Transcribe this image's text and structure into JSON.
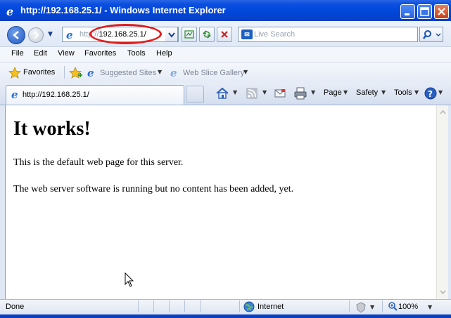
{
  "window": {
    "title": "http://192.168.25.1/ - Windows Internet Explorer"
  },
  "address_bar": {
    "prefix": "http://",
    "host": "192.168.25.1/"
  },
  "search": {
    "placeholder": "Live Search"
  },
  "menu": {
    "items": [
      "File",
      "Edit",
      "View",
      "Favorites",
      "Tools",
      "Help"
    ]
  },
  "favorites_bar": {
    "label": "Favorites",
    "links": [
      "Suggested Sites",
      "Web Slice Gallery"
    ]
  },
  "tab": {
    "label": "http://192.168.25.1/"
  },
  "command_bar": {
    "page": "Page",
    "safety": "Safety",
    "tools": "Tools"
  },
  "page": {
    "heading": "It works!",
    "paragraphs": [
      "This is the default web page for this server.",
      "The web server software is running but no content has been added, yet."
    ]
  },
  "status": {
    "text": "Done",
    "zone": "Internet",
    "zoom": "100%"
  },
  "colors": {
    "titlebar": "#0046d8",
    "annotation_ring": "#e01e1e"
  },
  "icons": [
    "ie-icon",
    "back-icon",
    "forward-icon",
    "refresh-icon",
    "stop-icon",
    "search-icon",
    "star-icon",
    "home-icon",
    "rss-icon",
    "mail-icon",
    "print-icon",
    "help-icon",
    "globe-icon",
    "zoom-icon",
    "cursor-icon"
  ]
}
